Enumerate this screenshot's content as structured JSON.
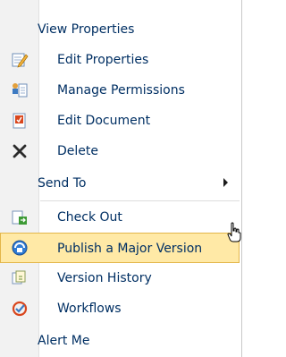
{
  "menu": {
    "view_properties": "View Properties",
    "edit_properties": "Edit Properties",
    "manage_permissions": "Manage Permissions",
    "edit_document": "Edit Document",
    "delete": "Delete",
    "send_to": "Send To",
    "check_out": "Check Out",
    "publish_major": "Publish a Major Version",
    "version_history": "Version History",
    "workflows": "Workflows",
    "alert_me": "Alert Me"
  },
  "colors": {
    "text": "#002f63",
    "highlight_bg": "#ffe9a6",
    "highlight_border": "#e3b64a",
    "gutter": "#f2f2f2"
  },
  "icons": {
    "edit_properties": "edit-properties-icon",
    "manage_permissions": "permissions-icon",
    "edit_document": "edit-document-icon",
    "delete": "delete-x-icon",
    "send_to": "submenu-arrow-icon",
    "check_out": "check-out-icon",
    "publish_major": "publish-icon",
    "version_history": "version-history-icon",
    "workflows": "workflow-icon",
    "cursor": "hand-cursor-icon"
  }
}
